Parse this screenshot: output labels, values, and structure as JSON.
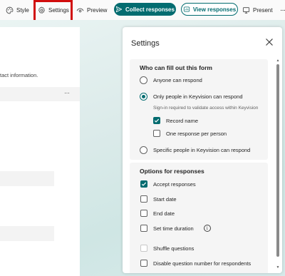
{
  "toolbar": {
    "style_label": "Style",
    "settings_label": "Settings",
    "preview_label": "Preview",
    "collect_label": "Collect responses",
    "view_label": "View responses",
    "present_label": "Present",
    "more_label": "···",
    "accent_color": "#036c70",
    "highlight_color": "#d10d0d"
  },
  "background": {
    "form_description_fragment": "tact information.",
    "row_more_label": "···"
  },
  "settings_panel": {
    "title": "Settings",
    "close_icon": "close-icon",
    "who_section": {
      "title": "Who can fill out this form",
      "options": [
        {
          "label": "Anyone can respond",
          "selected": false
        },
        {
          "label": "Only people in Keyvision can respond",
          "selected": true
        },
        {
          "label": "Specific people in Keyvision can respond",
          "selected": false
        }
      ],
      "hint": "Sign-in required to validate access within Keyvision",
      "sub_options": [
        {
          "label": "Record name",
          "checked": true
        },
        {
          "label": "One response per person",
          "checked": false
        }
      ]
    },
    "response_section": {
      "title": "Options for responses",
      "options": [
        {
          "label": "Accept responses",
          "checked": true
        },
        {
          "label": "Start date",
          "checked": false
        },
        {
          "label": "End date",
          "checked": false
        },
        {
          "label": "Set time duration",
          "checked": false
        },
        {
          "label": "Shuffle questions",
          "checked": false,
          "disabled": true
        },
        {
          "label": "Disable question number for respondents",
          "checked": false
        }
      ],
      "info_glyph": "i"
    }
  }
}
